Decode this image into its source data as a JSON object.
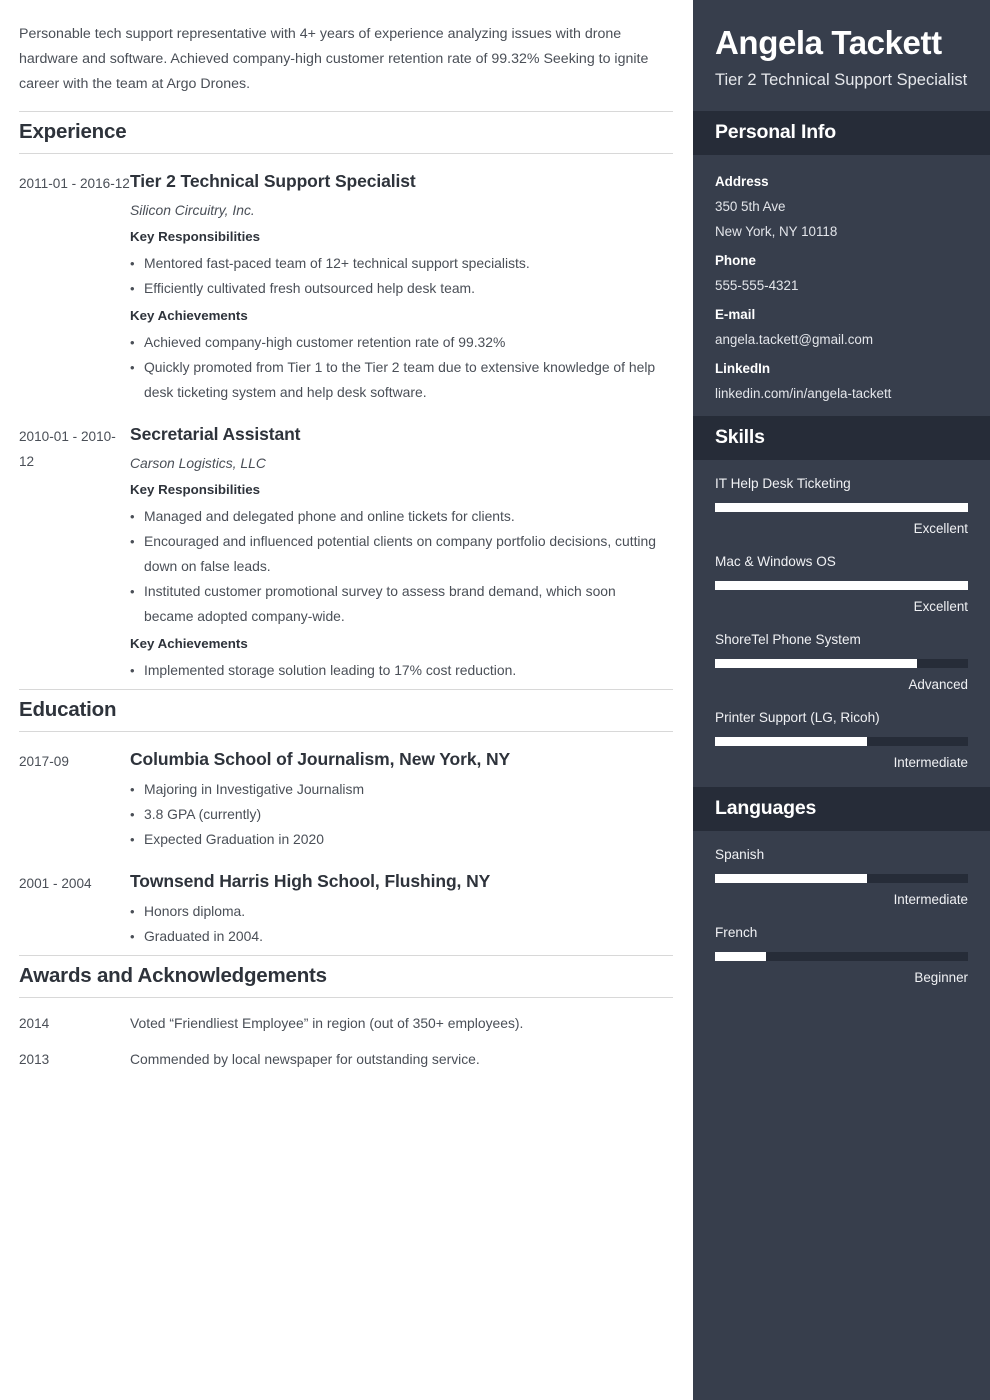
{
  "theme": {
    "sidebar_bg": "#373e4c",
    "sidebar_header_bg": "#262c38",
    "page_bg": "#ffffff",
    "text_color": "#4a4f57",
    "heading_color": "#2e333b",
    "bar_fill": "#ffffff"
  },
  "main": {
    "summary": "Personable tech support representative with 4+ years of experience analyzing issues with drone hardware and software. Achieved company-high customer retention rate of 99.32% Seeking to ignite career with the team at Argo Drones.",
    "sections": {
      "experience": {
        "title": "Experience",
        "entries": [
          {
            "date": "2011-01 - 2016-12",
            "title": "Tier 2 Technical Support Specialist",
            "org": "Silicon Circuitry, Inc.",
            "groups": [
              {
                "heading": "Key Responsibilities",
                "items": [
                  "Mentored fast-paced team of 12+ technical support specialists.",
                  "Efficiently cultivated fresh outsourced help desk team."
                ]
              },
              {
                "heading": "Key Achievements",
                "items": [
                  "Achieved company-high customer retention rate of 99.32%",
                  "Quickly promoted from Tier 1 to the Tier 2 team due to extensive knowledge of help desk ticketing system and help desk software."
                ]
              }
            ]
          },
          {
            "date": "2010-01 - 2010-12",
            "title": "Secretarial Assistant",
            "org": "Carson Logistics, LLC",
            "groups": [
              {
                "heading": "Key Responsibilities",
                "items": [
                  "Managed and delegated phone and online tickets for clients.",
                  "Encouraged and influenced potential clients on company portfolio decisions, cutting down on false leads.",
                  "Instituted customer promotional survey to assess brand demand, which soon became adopted company-wide."
                ]
              },
              {
                "heading": "Key Achievements",
                "items": [
                  "Implemented storage solution leading to 17% cost reduction."
                ]
              }
            ]
          }
        ]
      },
      "education": {
        "title": "Education",
        "entries": [
          {
            "date": "2017-09",
            "title": "Columbia School of Journalism, New York, NY",
            "items": [
              "Majoring in Investigative Journalism",
              "3.8 GPA (currently)",
              "Expected Graduation in 2020"
            ]
          },
          {
            "date": "2001 - 2004",
            "title": "Townsend Harris High School, Flushing, NY",
            "items": [
              "Honors diploma.",
              "Graduated in 2004."
            ]
          }
        ]
      },
      "awards": {
        "title": "Awards and Acknowledgements",
        "entries": [
          {
            "year": "2014",
            "text": "Voted “Friendliest Employee” in region (out of 350+ employees)."
          },
          {
            "year": "2013",
            "text": "Commended by local newspaper for outstanding service."
          }
        ]
      }
    }
  },
  "sidebar": {
    "name": "Angela Tackett",
    "role": "Tier 2 Technical Support Specialist",
    "personal_info": {
      "title": "Personal Info",
      "fields": [
        {
          "label": "Address",
          "values": [
            "350 5th Ave",
            "New York, NY 10118"
          ]
        },
        {
          "label": "Phone",
          "values": [
            "555-555-4321"
          ]
        },
        {
          "label": "E-mail",
          "values": [
            "angela.tackett@gmail.com"
          ]
        },
        {
          "label": "LinkedIn",
          "values": [
            "linkedin.com/in/angela-tackett"
          ]
        }
      ]
    },
    "skills": {
      "title": "Skills",
      "items": [
        {
          "name": "IT Help Desk Ticketing",
          "level": "Excellent",
          "percent": 100
        },
        {
          "name": "Mac & Windows OS",
          "level": "Excellent",
          "percent": 100
        },
        {
          "name": "ShoreTel Phone System",
          "level": "Advanced",
          "percent": 80
        },
        {
          "name": "Printer Support (LG, Ricoh)",
          "level": "Intermediate",
          "percent": 60
        }
      ]
    },
    "languages": {
      "title": "Languages",
      "items": [
        {
          "name": "Spanish",
          "level": "Intermediate",
          "percent": 60
        },
        {
          "name": "French",
          "level": "Beginner",
          "percent": 20
        }
      ]
    }
  }
}
